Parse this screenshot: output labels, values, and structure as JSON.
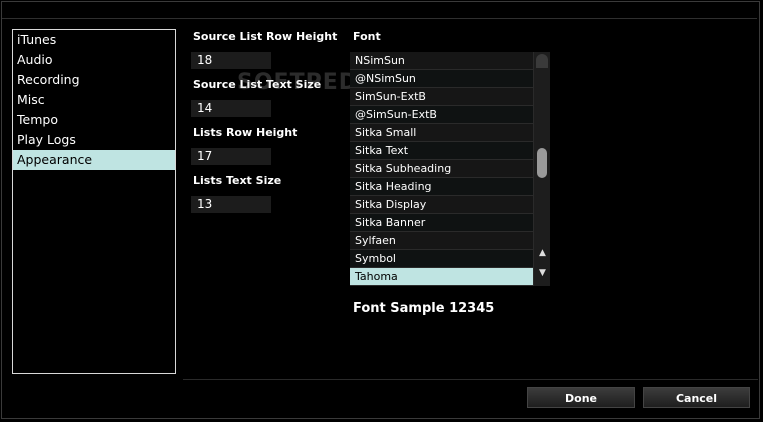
{
  "sidebar": {
    "items": [
      {
        "label": "iTunes",
        "selected": false
      },
      {
        "label": "Audio",
        "selected": false
      },
      {
        "label": "Recording",
        "selected": false
      },
      {
        "label": "Misc",
        "selected": false
      },
      {
        "label": "Tempo",
        "selected": false
      },
      {
        "label": "Play Logs",
        "selected": false
      },
      {
        "label": "Appearance",
        "selected": true
      }
    ]
  },
  "settings": {
    "source_list_row_height": {
      "label": "Source List Row Height",
      "value": "18"
    },
    "source_list_text_size": {
      "label": "Source List Text Size",
      "value": "14"
    },
    "lists_row_height": {
      "label": "Lists Row Height",
      "value": "17"
    },
    "lists_text_size": {
      "label": "Lists Text Size",
      "value": "13"
    }
  },
  "font": {
    "heading": "Font",
    "items": [
      "NSimSun",
      "@NSimSun",
      "SimSun-ExtB",
      "@SimSun-ExtB",
      "Sitka Small",
      "Sitka Text",
      "Sitka Subheading",
      "Sitka Heading",
      "Sitka Display",
      "Sitka Banner",
      "Sylfaen",
      "Symbol",
      "Tahoma"
    ],
    "selected": "Tahoma",
    "sample": "Font Sample 12345",
    "scroll_position": 0.55
  },
  "buttons": {
    "done": "Done",
    "cancel": "Cancel"
  },
  "watermark": "SOFTPEDIA",
  "icons": {
    "scroll_up": "▲",
    "scroll_down": "▼"
  },
  "colors": {
    "selection": "#bfe4e2",
    "background": "#000000"
  }
}
